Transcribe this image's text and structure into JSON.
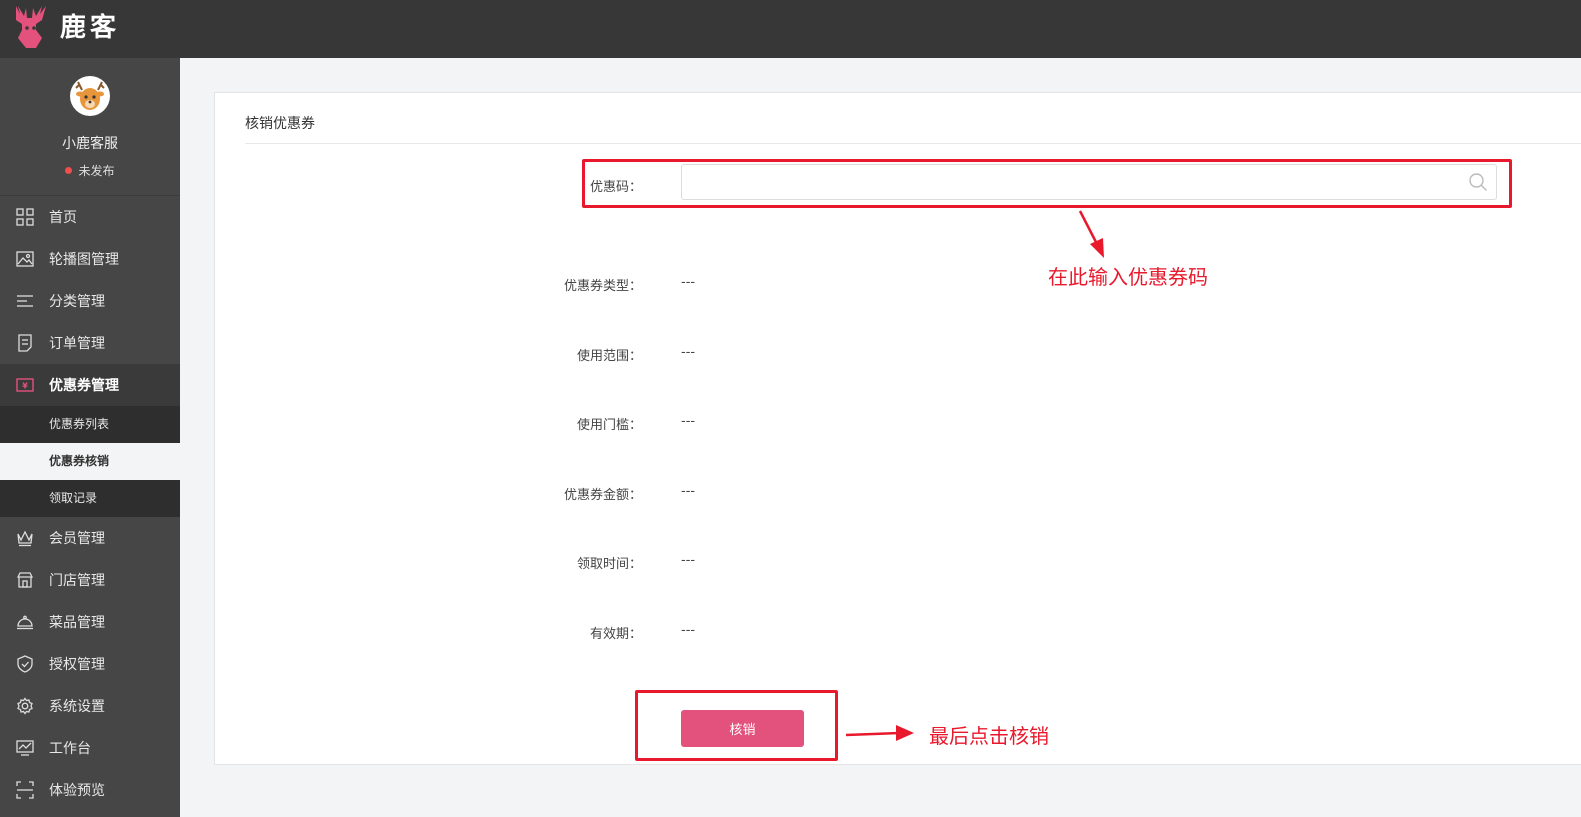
{
  "brand": {
    "name": "鹿客"
  },
  "profile": {
    "name": "小鹿客服",
    "status": "未发布"
  },
  "nav": [
    {
      "label": "首页",
      "icon": "grid-icon"
    },
    {
      "label": "轮播图管理",
      "icon": "image-icon"
    },
    {
      "label": "分类管理",
      "icon": "list-icon"
    },
    {
      "label": "订单管理",
      "icon": "order-icon"
    },
    {
      "label": "优惠券管理",
      "icon": "coupon-icon",
      "active": true,
      "children": [
        {
          "label": "优惠券列表"
        },
        {
          "label": "优惠券核销",
          "active": true
        },
        {
          "label": "领取记录"
        }
      ]
    },
    {
      "label": "会员管理",
      "icon": "crown-icon"
    },
    {
      "label": "门店管理",
      "icon": "store-icon"
    },
    {
      "label": "菜品管理",
      "icon": "cloche-icon"
    },
    {
      "label": "授权管理",
      "icon": "shield-icon"
    },
    {
      "label": "系统设置",
      "icon": "gear-icon"
    },
    {
      "label": "工作台",
      "icon": "monitor-icon"
    },
    {
      "label": "体验预览",
      "icon": "scan-icon"
    }
  ],
  "card": {
    "title": "核销优惠券",
    "code_label": "优惠码：",
    "code_value": "",
    "code_placeholder": "",
    "fields": [
      {
        "label": "优惠券类型：",
        "value": "---"
      },
      {
        "label": "使用范围：",
        "value": "---"
      },
      {
        "label": "使用门槛：",
        "value": "---"
      },
      {
        "label": "优惠券金额：",
        "value": "---"
      },
      {
        "label": "领取时间：",
        "value": "---"
      },
      {
        "label": "有效期：",
        "value": "---"
      }
    ],
    "submit_label": "核销"
  },
  "annotations": {
    "input_hint": "在此输入优惠券码",
    "button_hint": "最后点击核销"
  },
  "colors": {
    "accent": "#e2527d",
    "annotation": "#e8192c",
    "topbar": "#373737",
    "sidebar": "#464646"
  }
}
